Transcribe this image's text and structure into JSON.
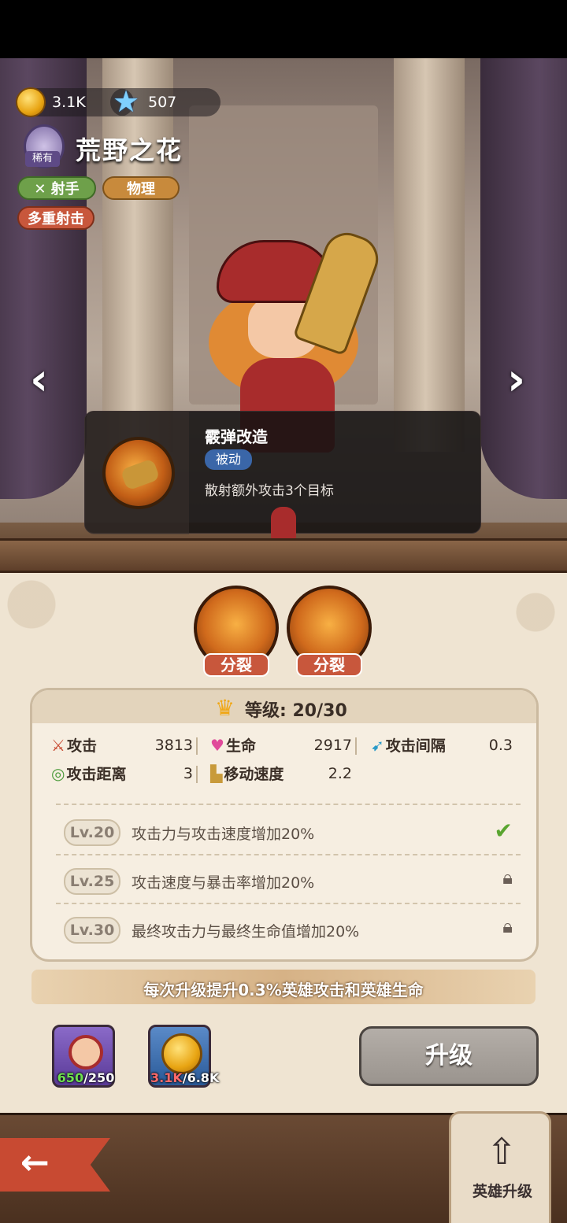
{
  "resources": {
    "gold": "3.1K",
    "gems": "507"
  },
  "hero": {
    "name": "荒野之花",
    "rarity": "稀有",
    "tags": [
      "射手",
      "物理",
      "多重射击"
    ]
  },
  "skill": {
    "name": "霰弹改造",
    "type": "被动",
    "description": "散射额外攻击3个目标"
  },
  "branches": [
    {
      "label": "分裂",
      "icon": "cluster-shot-icon"
    },
    {
      "label": "分裂",
      "icon": "cannon-icon"
    }
  ],
  "level": {
    "label": "等级:",
    "value": "20/30"
  },
  "stats": [
    {
      "label": "攻击",
      "value": "3813",
      "icon": "sword-icon"
    },
    {
      "label": "生命",
      "value": "2917",
      "icon": "heart-icon"
    },
    {
      "label": "攻击间隔",
      "value": "0.3",
      "icon": "speed-icon"
    },
    {
      "label": "攻击距离",
      "value": "3",
      "icon": "range-icon"
    },
    {
      "label": "移动速度",
      "value": "2.2",
      "icon": "boot-icon"
    }
  ],
  "level_bonuses": [
    {
      "level": "Lv.20",
      "text": "攻击力与攻击速度增加20%",
      "status": "unlocked"
    },
    {
      "level": "Lv.25",
      "text": "攻击速度与暴击率增加20%",
      "status": "locked"
    },
    {
      "level": "Lv.30",
      "text": "最终攻击力与最终生命值增加20%",
      "status": "locked"
    }
  ],
  "upgrade_info": "每次升级提升0.3%英雄攻击和英雄生命",
  "costs": {
    "shards_have": "650",
    "shards_need": "/250",
    "gold_have": "3.1K",
    "gold_need": "/6.8K"
  },
  "upgrade_button": "升级",
  "nav": {
    "back": "←",
    "hero_upgrade": "英雄升级"
  },
  "colors": {
    "accent_red": "#c8573c",
    "parchment": "#efe4d2",
    "check_green": "#5aa530"
  }
}
